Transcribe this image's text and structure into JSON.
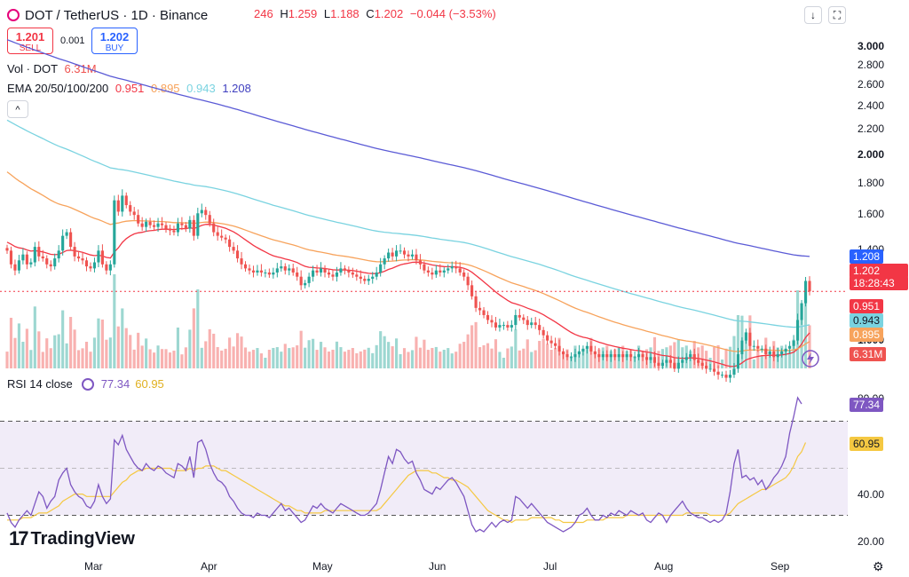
{
  "header": {
    "symbol": "DOT / TetherUS · 1D · Binance",
    "ohlc": {
      "o_value": "246",
      "h_label": "H",
      "h_value": "1.259",
      "l_label": "L",
      "l_value": "1.188",
      "c_label": "C",
      "c_value": "1.202",
      "change": "−0.044 (−3.53%)"
    },
    "down_icon": "↓",
    "layout_icon": "⛶"
  },
  "trade": {
    "sell_price": "1.201",
    "sell_label": "SELL",
    "spread": "0.001",
    "buy_price": "1.202",
    "buy_label": "BUY"
  },
  "indicators": {
    "vol_label": "Vol · DOT",
    "vol_value": "6.31M",
    "ema_label": "EMA 20/50/100/200",
    "ema20": "0.951",
    "ema50": "0.895",
    "ema100": "0.943",
    "ema200": "1.208",
    "collapse_icon": "^"
  },
  "rsi_panel": {
    "label": "RSI 14 close",
    "rsi_value": "77.34",
    "ma_value": "60.95"
  },
  "brand": {
    "name": "TradingView",
    "mark": "17"
  },
  "colors": {
    "up": "#26a69a",
    "down": "#ef5350",
    "ema20": "#f23645",
    "ema50": "#f7a35c",
    "ema100": "#7ad3e0",
    "ema200": "#5b5bd6",
    "rsi": "#7e57c2",
    "rsi_ma": "#f5c842",
    "price_line": "#f23645"
  },
  "price_axis": {
    "ticks": [
      "3.000",
      "2.800",
      "2.600",
      "2.400",
      "2.200",
      "2.000",
      "1.800",
      "1.600",
      "1.400",
      "1.000"
    ],
    "badges": {
      "ema200": "1.208",
      "last": "1.202",
      "countdown": "18:28:43",
      "ema20": "0.951",
      "ema100": "0.943",
      "ema50": "0.895",
      "volume": "6.31M"
    }
  },
  "rsi_axis": {
    "ticks": [
      "80.00",
      "40.00",
      "20.00"
    ],
    "badges": {
      "rsi": "77.34",
      "ma": "60.95"
    }
  },
  "time_axis": {
    "labels": [
      "Mar",
      "Apr",
      "May",
      "Jun",
      "Jul",
      "Aug",
      "Sep"
    ]
  },
  "chart_data": {
    "type": "candlestick",
    "title": "DOT / TetherUS · 1D · Binance",
    "ylim": [
      0.68,
      3.0
    ],
    "log_scale": true,
    "grid": false,
    "x_range": [
      "Feb 7",
      "Sep 9"
    ],
    "month_labels": [
      "Mar",
      "Apr",
      "May",
      "Jun",
      "Jul",
      "Aug",
      "Sep"
    ],
    "close_approx": [
      1.4,
      1.33,
      1.3,
      1.35,
      1.38,
      1.33,
      1.34,
      1.42,
      1.37,
      1.36,
      1.33,
      1.32,
      1.36,
      1.4,
      1.48,
      1.5,
      1.42,
      1.37,
      1.36,
      1.35,
      1.32,
      1.31,
      1.34,
      1.4,
      1.33,
      1.3,
      1.33,
      1.69,
      1.62,
      1.72,
      1.66,
      1.62,
      1.6,
      1.55,
      1.53,
      1.56,
      1.54,
      1.53,
      1.55,
      1.54,
      1.52,
      1.51,
      1.5,
      1.55,
      1.54,
      1.52,
      1.57,
      1.48,
      1.61,
      1.63,
      1.6,
      1.55,
      1.5,
      1.48,
      1.47,
      1.46,
      1.42,
      1.4,
      1.36,
      1.33,
      1.31,
      1.3,
      1.29,
      1.3,
      1.29,
      1.29,
      1.28,
      1.29,
      1.31,
      1.32,
      1.3,
      1.31,
      1.29,
      1.27,
      1.23,
      1.24,
      1.27,
      1.3,
      1.29,
      1.31,
      1.29,
      1.28,
      1.27,
      1.29,
      1.31,
      1.3,
      1.29,
      1.28,
      1.27,
      1.26,
      1.25,
      1.26,
      1.27,
      1.29,
      1.33,
      1.36,
      1.39,
      1.37,
      1.4,
      1.4,
      1.38,
      1.37,
      1.38,
      1.35,
      1.33,
      1.3,
      1.29,
      1.28,
      1.3,
      1.29,
      1.3,
      1.31,
      1.32,
      1.31,
      1.29,
      1.27,
      1.23,
      1.18,
      1.13,
      1.12,
      1.1,
      1.08,
      1.07,
      1.05,
      1.06,
      1.06,
      1.05,
      1.06,
      1.1,
      1.09,
      1.08,
      1.06,
      1.07,
      1.06,
      1.04,
      1.02,
      1.0,
      0.99,
      0.98,
      0.96,
      0.95,
      0.94,
      0.94,
      0.95,
      0.96,
      0.97,
      0.98,
      0.96,
      0.95,
      0.94,
      0.95,
      0.94,
      0.95,
      0.94,
      0.95,
      0.94,
      0.95,
      0.94,
      0.94,
      0.95,
      0.94,
      0.93,
      0.94,
      0.92,
      0.91,
      0.92,
      0.93,
      0.92,
      0.9,
      0.92,
      0.93,
      0.94,
      0.95,
      0.93,
      0.92,
      0.91,
      0.9,
      0.9,
      0.89,
      0.88,
      0.88,
      0.87,
      0.88,
      0.9,
      0.95,
      1.0,
      1.03,
      0.98,
      0.98,
      0.97,
      0.97,
      0.95,
      0.96,
      0.94,
      0.95,
      0.96,
      0.97,
      0.98,
      1.0,
      1.08,
      1.15,
      1.25,
      1.202
    ],
    "volume_note": "histogram colored up/down per candle",
    "ema": [
      {
        "name": "EMA 20",
        "value": 0.951
      },
      {
        "name": "EMA 50",
        "value": 0.895
      },
      {
        "name": "EMA 100",
        "value": 0.943
      },
      {
        "name": "EMA 200",
        "value": 1.208
      }
    ],
    "rsi": {
      "period": 14,
      "ylim": [
        20,
        85
      ],
      "bands": [
        30,
        70
      ],
      "current": 77.34,
      "ma_current": 60.95,
      "rsi_values": [
        31,
        27,
        25,
        28,
        30,
        32,
        30,
        35,
        40,
        38,
        33,
        36,
        38,
        45,
        48,
        50,
        43,
        40,
        38,
        37,
        34,
        33,
        36,
        43,
        38,
        35,
        37,
        62,
        60,
        64,
        58,
        55,
        52,
        50,
        49,
        52,
        50,
        49,
        51,
        50,
        48,
        47,
        46,
        52,
        51,
        49,
        55,
        46,
        61,
        62,
        58,
        52,
        48,
        45,
        44,
        42,
        38,
        36,
        33,
        31,
        30,
        30,
        29,
        31,
        30,
        30,
        29,
        31,
        33,
        35,
        32,
        33,
        31,
        29,
        27,
        28,
        31,
        34,
        33,
        35,
        33,
        32,
        31,
        33,
        35,
        34,
        33,
        32,
        31,
        30,
        30,
        31,
        33,
        35,
        41,
        48,
        55,
        52,
        58,
        57,
        54,
        52,
        53,
        48,
        45,
        41,
        40,
        39,
        42,
        41,
        43,
        45,
        46,
        44,
        41,
        38,
        32,
        26,
        23,
        24,
        23,
        25,
        27,
        25,
        27,
        28,
        27,
        28,
        38,
        37,
        35,
        33,
        35,
        33,
        31,
        29,
        27,
        26,
        25,
        24,
        23,
        24,
        25,
        27,
        30,
        31,
        33,
        30,
        28,
        28,
        30,
        29,
        31,
        30,
        32,
        31,
        30,
        32,
        31,
        30,
        31,
        28,
        27,
        29,
        31,
        30,
        27,
        30,
        32,
        34,
        36,
        33,
        31,
        30,
        29,
        29,
        28,
        27,
        28,
        27,
        28,
        31,
        40,
        52,
        58,
        46,
        47,
        45,
        46,
        43,
        45,
        41,
        43,
        46,
        48,
        51,
        55,
        65,
        72,
        80,
        77.34
      ],
      "ma_values": [
        28,
        28,
        28,
        28,
        29,
        29,
        29,
        30,
        31,
        31,
        31,
        32,
        33,
        34,
        36,
        37,
        38,
        39,
        39,
        39,
        38,
        38,
        38,
        38,
        38,
        38,
        38,
        40,
        42,
        44,
        45,
        47,
        48,
        49,
        49,
        50,
        50,
        50,
        50,
        50,
        50,
        50,
        49,
        49,
        49,
        49,
        50,
        49,
        50,
        50,
        51,
        51,
        51,
        50,
        49,
        49,
        48,
        47,
        46,
        45,
        44,
        43,
        42,
        41,
        40,
        39,
        38,
        37,
        36,
        35,
        34,
        34,
        33,
        32,
        32,
        31,
        31,
        31,
        31,
        31,
        32,
        32,
        32,
        32,
        32,
        32,
        32,
        32,
        32,
        32,
        32,
        32,
        32,
        32,
        33,
        35,
        37,
        39,
        41,
        43,
        45,
        47,
        48,
        49,
        49,
        49,
        49,
        48,
        48,
        47,
        46,
        46,
        45,
        45,
        44,
        43,
        42,
        40,
        38,
        36,
        34,
        32,
        31,
        30,
        29,
        28,
        28,
        27,
        28,
        28,
        28,
        28,
        29,
        29,
        29,
        29,
        29,
        29,
        28,
        28,
        27,
        27,
        27,
        27,
        27,
        27,
        28,
        28,
        28,
        28,
        28,
        29,
        29,
        29,
        29,
        29,
        30,
        30,
        30,
        30,
        30,
        30,
        30,
        30,
        30,
        30,
        30,
        30,
        30,
        30,
        30,
        31,
        31,
        31,
        31,
        31,
        31,
        30,
        30,
        30,
        30,
        30,
        31,
        33,
        35,
        36,
        37,
        38,
        39,
        40,
        41,
        41,
        42,
        43,
        44,
        45,
        46,
        48,
        51,
        55,
        57,
        60.95
      ]
    }
  }
}
